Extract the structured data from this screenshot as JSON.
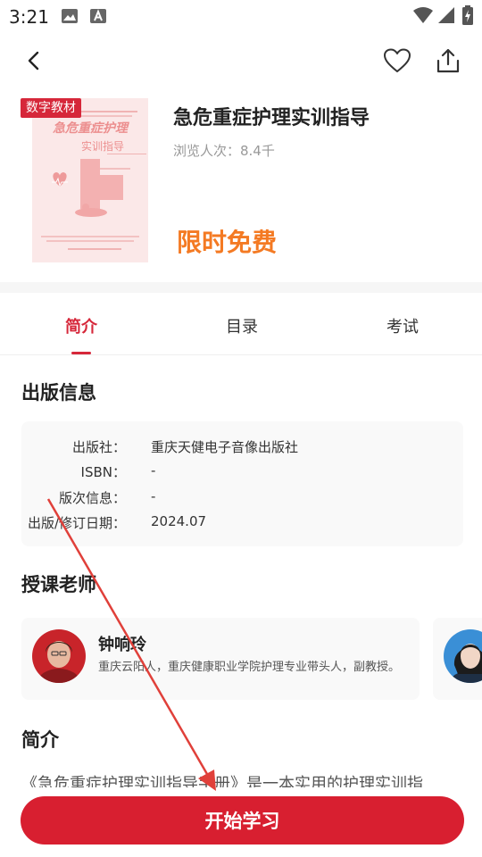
{
  "status_bar": {
    "time": "3:21"
  },
  "nav": {
    "back_icon": "chevron-left-icon",
    "favorite_icon": "heart-icon",
    "share_icon": "share-icon"
  },
  "book": {
    "badge": "数字教材",
    "cover_title": "急危重症护理",
    "cover_subtitle": "实训指导",
    "title": "急危重症护理实训指导",
    "views": "浏览人次：8.4千",
    "free_label": "限时免费"
  },
  "tabs": [
    {
      "label": "简介",
      "active": true
    },
    {
      "label": "目录",
      "active": false
    },
    {
      "label": "考试",
      "active": false
    }
  ],
  "publish_info": {
    "heading": "出版信息",
    "rows": [
      {
        "label": "出版社：",
        "value": "重庆天健电子音像出版社"
      },
      {
        "label": "ISBN：",
        "value": "-"
      },
      {
        "label": "版次信息：",
        "value": "-"
      },
      {
        "label": "出版/修订日期：",
        "value": "2024.07"
      }
    ]
  },
  "teachers": {
    "heading": "授课老师",
    "items": [
      {
        "name": "钟响玲",
        "description": "重庆云阳人，重庆健康职业学院护理专业带头人，副教授。"
      }
    ]
  },
  "intro": {
    "heading": "简介",
    "text": "《急危重症护理实训指导手册》是一本实用的护理实训指"
  },
  "actions": {
    "start_label": "开始学习"
  },
  "colors": {
    "accent": "#d6273a",
    "free": "#f47a23",
    "annotation_arrow": "#e0403a"
  }
}
